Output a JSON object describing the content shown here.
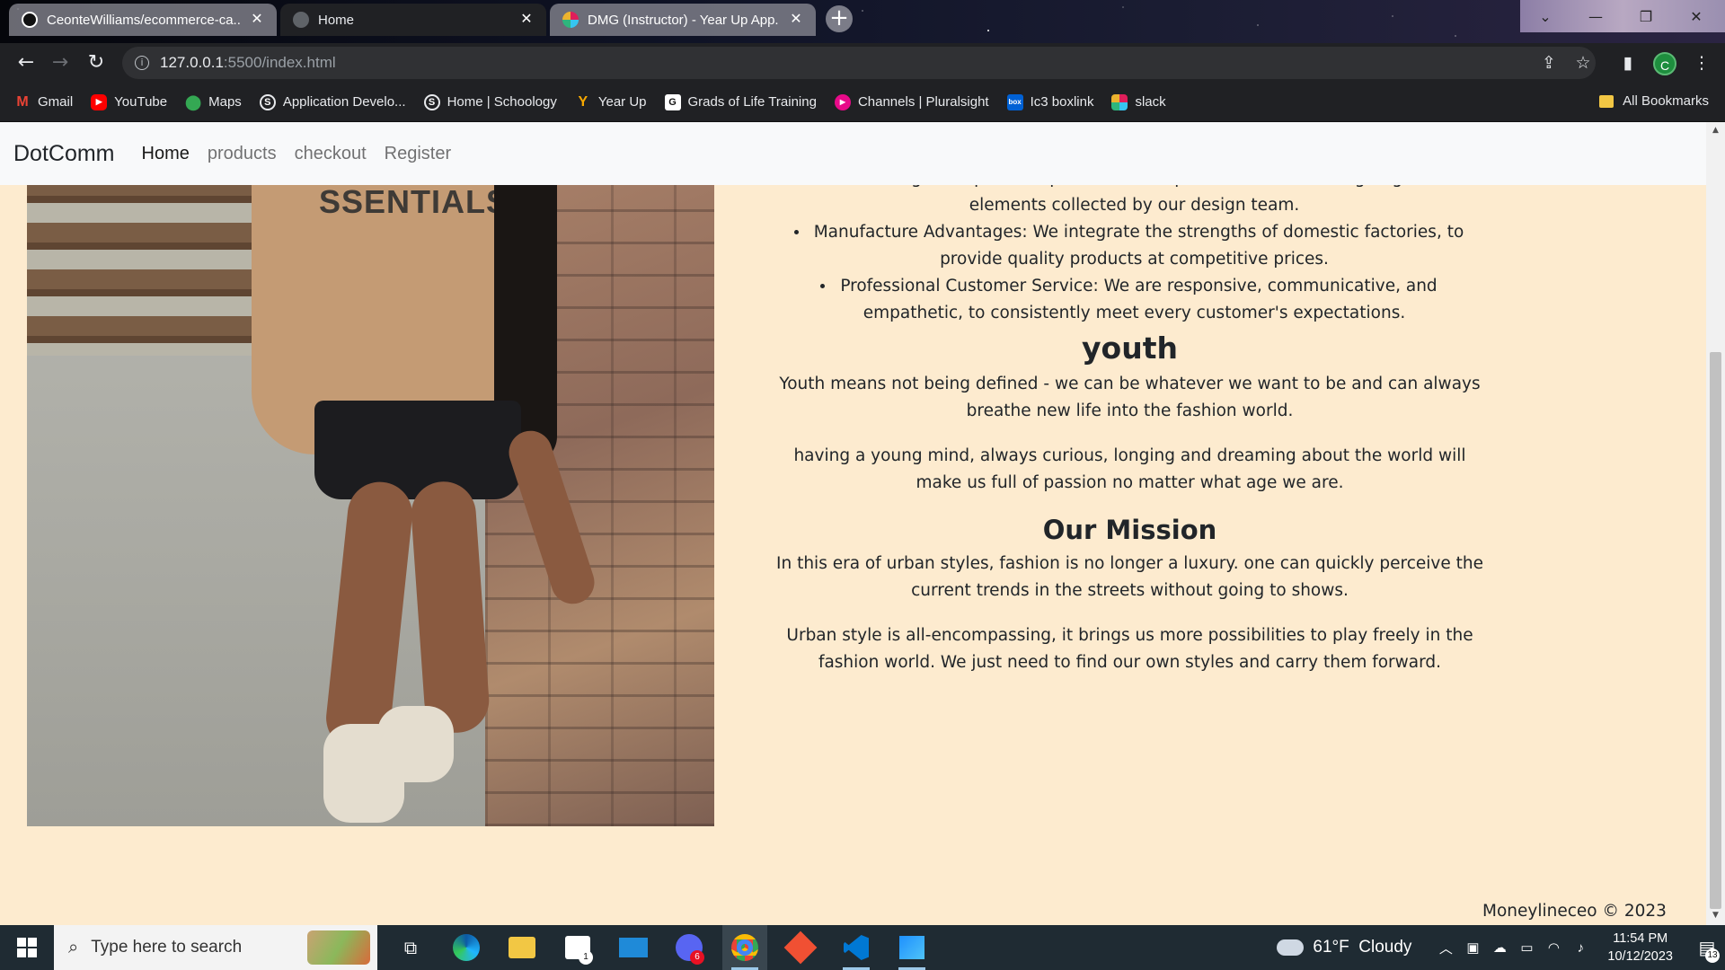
{
  "browser": {
    "tabs": [
      {
        "title": "CeonteWilliams/ecommerce-ca...",
        "state": "inactive",
        "icon": "github-icon"
      },
      {
        "title": "Home",
        "state": "active",
        "icon": "globe-icon"
      },
      {
        "title": "DMG (Instructor) - Year Up App...",
        "state": "inactive",
        "icon": "slack-icon"
      }
    ],
    "url_host": "127.0.0.1",
    "url_rest": ":5500/index.html",
    "profile_initial": "C",
    "bookmarks": [
      {
        "label": "Gmail",
        "icon": "gmail-icon",
        "color": "#ea4335"
      },
      {
        "label": "YouTube",
        "icon": "youtube-icon",
        "color": "#ff0000"
      },
      {
        "label": "Maps",
        "icon": "maps-icon",
        "color": "#34a853"
      },
      {
        "label": "Application Develo...",
        "icon": "schoology-icon",
        "color": "#2a2a2a"
      },
      {
        "label": "Home | Schoology",
        "icon": "schoology-icon",
        "color": "#2a2a2a"
      },
      {
        "label": "Year Up",
        "icon": "yearup-icon",
        "color": "#f7a800"
      },
      {
        "label": "Grads of Life Training",
        "icon": "gradsoflife-icon",
        "color": "#ffffff"
      },
      {
        "label": "Channels | Pluralsight",
        "icon": "pluralsight-icon",
        "color": "#e80a89"
      },
      {
        "label": "Ic3 boxlink",
        "icon": "box-icon",
        "color": "#0061d5"
      },
      {
        "label": "slack",
        "icon": "slack-icon",
        "color": "#4a154b"
      }
    ],
    "all_bookmarks_label": "All Bookmarks"
  },
  "site": {
    "brand": "DotComm",
    "nav": [
      {
        "label": "Home",
        "active": true
      },
      {
        "label": "products",
        "active": false
      },
      {
        "label": "checkout",
        "active": false
      },
      {
        "label": "Register",
        "active": false
      }
    ],
    "hoodie_text": "SSENTIALS",
    "features": [
      "Personal Design: We promote product development with the cutting-edge fashion elements collected by our design team.",
      "Manufacture Advantages: We integrate the strengths of domestic factories, to provide quality products at competitive prices.",
      "Professional Customer Service: We are responsive, communicative, and empathetic, to consistently meet every customer's expectations."
    ],
    "youth_heading": "youth",
    "youth_p1": "Youth means not being defined - we can be whatever we want to be and can always breathe new life into the fashion world.",
    "youth_p2": "having a young mind, always curious, longing and dreaming about the world will make us full of passion no matter what age we are.",
    "mission_heading": "Our Mission",
    "mission_p1": "In this era of urban styles, fashion is no longer a luxury. one can quickly perceive the current trends in the streets without going to shows.",
    "mission_p2": "Urban style is all-encompassing, it brings us more possibilities to play freely in the fashion world. We just need to find our own styles and carry them forward.",
    "footer": "Moneylineceo © 2023",
    "background_color": "#fdebcf"
  },
  "taskbar": {
    "search_placeholder": "Type here to search",
    "apps": [
      {
        "name": "task-view-icon",
        "badge": ""
      },
      {
        "name": "edge-icon",
        "badge": ""
      },
      {
        "name": "file-explorer-icon",
        "badge": ""
      },
      {
        "name": "microsoft-store-icon",
        "badge": "1"
      },
      {
        "name": "mail-icon",
        "badge": ""
      },
      {
        "name": "game-app-icon",
        "badge": "6"
      },
      {
        "name": "chrome-icon",
        "badge": ""
      },
      {
        "name": "git-icon",
        "badge": ""
      },
      {
        "name": "vscode-icon",
        "badge": ""
      },
      {
        "name": "photos-icon",
        "badge": ""
      }
    ],
    "weather": "61°F  Cloudy",
    "time": "11:54 PM",
    "date": "10/12/2023",
    "notifications": "13"
  }
}
